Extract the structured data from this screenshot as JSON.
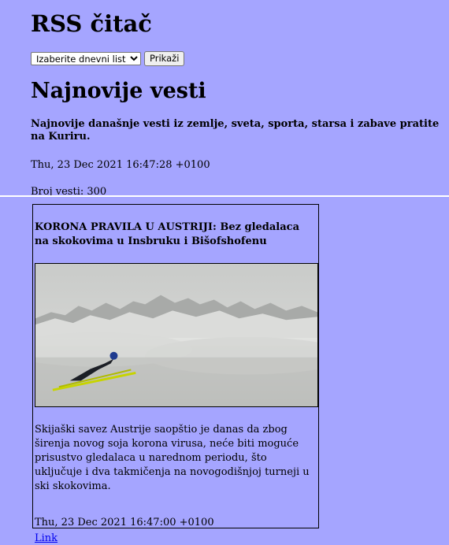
{
  "app": {
    "title": "RSS čitač"
  },
  "controls": {
    "select_value": "Izaberite dnevni list",
    "show_label": "Prikaži"
  },
  "feed": {
    "title": "Najnovije vesti",
    "description": "Najnovije današnje vesti iz zemlje, sveta, sporta, starsa i zabave pratite na Kuriru.",
    "date": "Thu, 23 Dec 2021 16:47:28 +0100",
    "count_label": "Broj vesti: 300"
  },
  "items": [
    {
      "title": "KORONA PRAVILA U AUSTRIJI: Bez gledalaca na skokovima u Insbruku i Bišofshofenu",
      "description": "Skijaški savez Austrije saopštio je danas da zbog širenja novog soja korona virusa, neće biti moguće prisustvo gledalaca u narednom periodu, što uključuje i dva takmičenja na novogodišnjoj turneji u ski skokovima.",
      "date": "Thu, 23 Dec 2021 16:47:00 +0100",
      "link_label": "Link"
    }
  ],
  "colors": {
    "background": "#a5a5ff",
    "link": "#0000ee"
  }
}
